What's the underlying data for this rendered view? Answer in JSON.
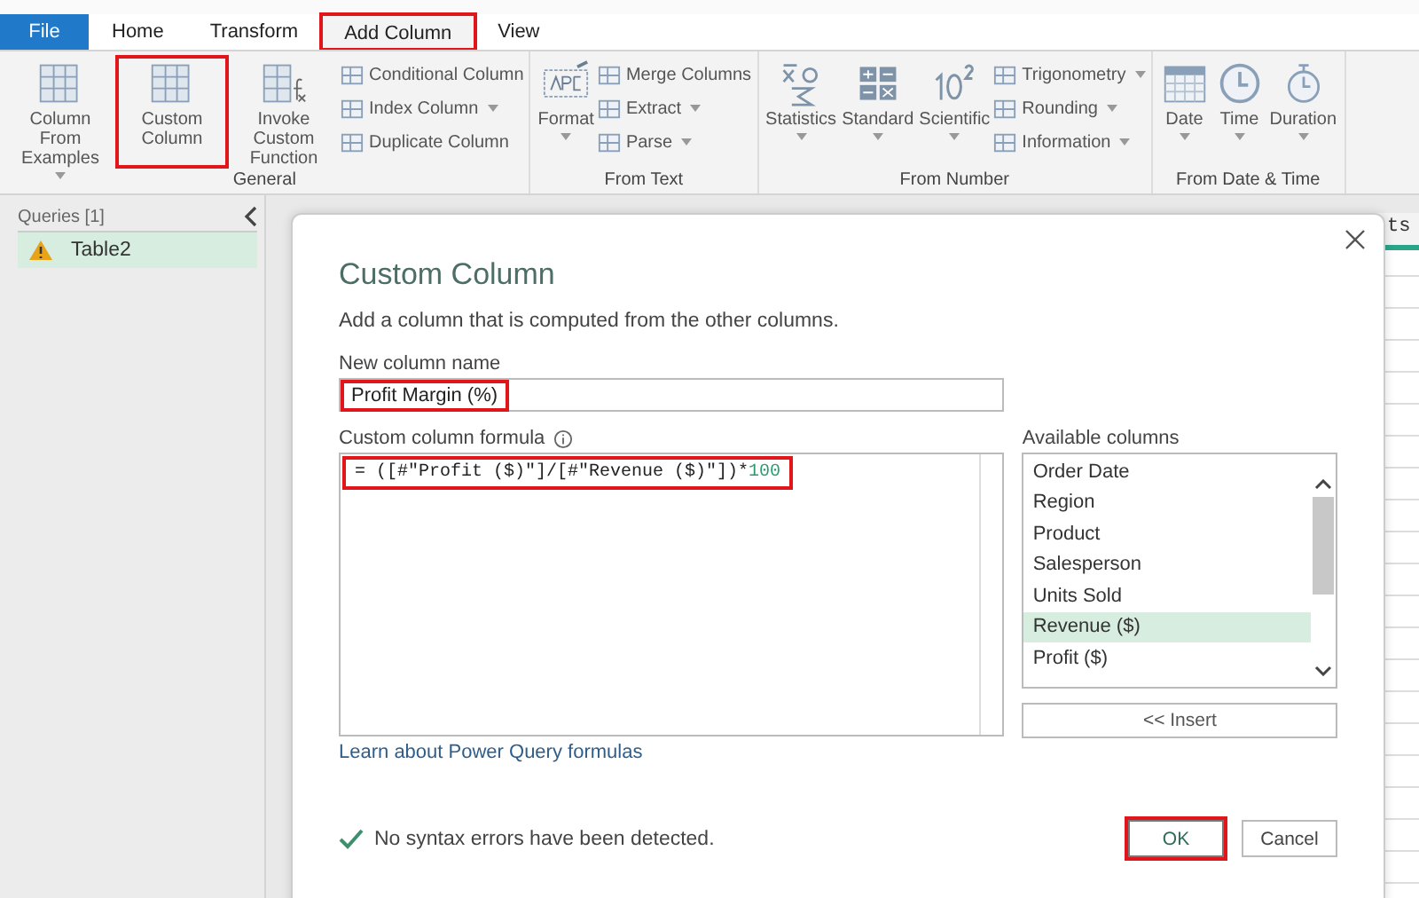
{
  "ribbon_tabs": [
    {
      "label": "File",
      "selected": false,
      "kind": "file",
      "highlighted": false
    },
    {
      "label": "Home",
      "selected": false,
      "kind": "tab",
      "highlighted": false
    },
    {
      "label": "Transform",
      "selected": false,
      "kind": "tab",
      "highlighted": false
    },
    {
      "label": "Add Column",
      "selected": true,
      "kind": "tab",
      "highlighted": true
    },
    {
      "label": "View",
      "selected": false,
      "kind": "tab",
      "highlighted": false
    }
  ],
  "ribbon_groups": [
    {
      "label": "General",
      "large": [
        {
          "label": "Column From Examples",
          "dropdown": true,
          "highlighted": false
        },
        {
          "label": "Custom Column",
          "dropdown": false,
          "highlighted": true
        },
        {
          "label": "Invoke Custom Function",
          "dropdown": false,
          "highlighted": false
        }
      ],
      "small": [
        {
          "label": "Conditional Column",
          "dropdown": false
        },
        {
          "label": "Index Column",
          "dropdown": true
        },
        {
          "label": "Duplicate Column",
          "dropdown": false
        }
      ]
    },
    {
      "label": "From Text",
      "large": [
        {
          "label": "Format",
          "dropdown": true,
          "highlighted": false
        }
      ],
      "small": [
        {
          "label": "Merge Columns",
          "dropdown": false
        },
        {
          "label": "Extract",
          "dropdown": true
        },
        {
          "label": "Parse",
          "dropdown": true
        }
      ]
    },
    {
      "label": "From Number",
      "large": [
        {
          "label": "Statistics",
          "dropdown": true,
          "highlighted": false
        },
        {
          "label": "Standard",
          "dropdown": true,
          "highlighted": false
        },
        {
          "label": "Scientific",
          "dropdown": true,
          "highlighted": false
        }
      ],
      "small": [
        {
          "label": "Trigonometry",
          "dropdown": true
        },
        {
          "label": "Rounding",
          "dropdown": true
        },
        {
          "label": "Information",
          "dropdown": true
        }
      ]
    },
    {
      "label": "From Date & Time",
      "large": [
        {
          "label": "Date",
          "dropdown": true,
          "highlighted": false
        },
        {
          "label": "Time",
          "dropdown": true,
          "highlighted": false
        },
        {
          "label": "Duration",
          "dropdown": true,
          "highlighted": false
        }
      ]
    }
  ],
  "queries": {
    "title": "Queries [1]",
    "items": [
      {
        "name": "Table2",
        "selected": true,
        "warning": true
      }
    ]
  },
  "background_table": {
    "column_header": "ts"
  },
  "dialog": {
    "title": "Custom Column",
    "description": "Add a column that is computed from the other columns.",
    "name_label": "New column name",
    "name_value": "Profit Margin (%)",
    "name_highlighted": true,
    "formula_label": "Custom column formula",
    "formula": [
      {
        "kind": "code",
        "text": "= ([#\"Profit ($)\"]/[#\"Revenue ($)\"])*"
      },
      {
        "kind": "number",
        "text": "100"
      }
    ],
    "formula_highlighted": true,
    "available_label": "Available columns",
    "columns": [
      {
        "name": "Order Date",
        "selected": false
      },
      {
        "name": "Region",
        "selected": false
      },
      {
        "name": "Product",
        "selected": false
      },
      {
        "name": "Salesperson",
        "selected": false
      },
      {
        "name": "Units Sold",
        "selected": false
      },
      {
        "name": "Revenue ($)",
        "selected": true
      },
      {
        "name": "Profit ($)",
        "selected": false
      }
    ],
    "insert_button": "<< Insert",
    "link": "Learn about Power Query formulas",
    "status": "No syntax errors have been detected.",
    "buttons": [
      {
        "label": "OK",
        "highlighted": true
      },
      {
        "label": "Cancel",
        "highlighted": false
      }
    ]
  }
}
